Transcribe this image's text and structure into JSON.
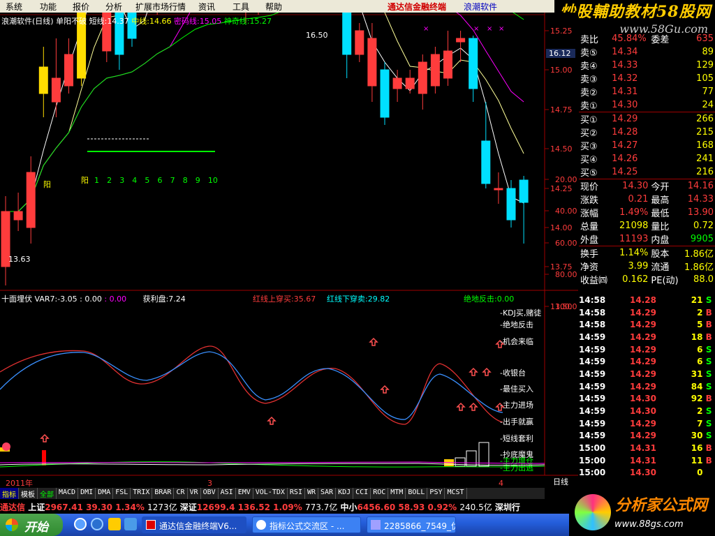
{
  "menu": [
    "系统",
    "功能",
    "报价",
    "分析",
    "扩展市场行情",
    "资讯",
    "工具",
    "帮助"
  ],
  "brand": {
    "name": "通达信金融终端",
    "suffix": "浪潮软件"
  },
  "watermark": {
    "title": "炒股輔助教材58股网",
    "url": "www.58Gu.com"
  },
  "header": {
    "stock": "浪潮软件(日线)",
    "pattern": "单阳不破",
    "short_label": "短线:",
    "short_val": "14.37",
    "mid_label": "中线:",
    "mid_val": "14.66",
    "secret_label": "密码线:",
    "secret_val": "15.05",
    "oracle_label": "神奇线:",
    "oracle_val": "15.27"
  },
  "price_axis": [
    "16.12",
    "16.00",
    "15.75",
    "15.50",
    "15.25",
    "15.00",
    "14.75",
    "14.50",
    "14.25",
    "14.00",
    "13.75",
    "13.50"
  ],
  "high_label": "16.50",
  "low_label": "13.63",
  "yang_labels": {
    "left": "阳",
    "right": "阳",
    "counts": [
      "1",
      "2",
      "3",
      "4",
      "5",
      "6",
      "7",
      "8",
      "9",
      "10"
    ]
  },
  "indicator": {
    "name": "十面埋伏",
    "var_label": "VAR7:",
    "var_val": "-3.05",
    "v1": ": 0.00",
    "v2": ": 0.00",
    "profit_label": "获利盘:",
    "profit_val": "7.24",
    "red_cross_label": "红线上穿买:",
    "red_cross_val": "35.67",
    "blue_cross_label": "红线下穿卖:",
    "blue_cross_val": "29.82",
    "fight_label": "绝地反击:",
    "fight_val": "0.00"
  },
  "indicator_axis": [
    "100.0",
    "80.00",
    "60.00",
    "40.00",
    "20.00"
  ],
  "legend": [
    "KDJ买,赌徒",
    "绝地反击",
    "机会来临",
    "收银台",
    "最佳买入",
    "主力进场",
    "出手就赢",
    "短线套利",
    "抄底魔鬼",
    "主力增仓",
    "主力出逃"
  ],
  "date_axis": {
    "year": "2011年",
    "m3": "3",
    "m4": "4",
    "period": "日线"
  },
  "order_book": {
    "top_left": "卖比",
    "top_val": "45.84%",
    "top_right": "委差",
    "top_right_val": "635",
    "asks": [
      {
        "l": "卖⑤",
        "p": "14.34",
        "v": "89"
      },
      {
        "l": "卖④",
        "p": "14.33",
        "v": "129"
      },
      {
        "l": "卖③",
        "p": "14.32",
        "v": "105"
      },
      {
        "l": "卖②",
        "p": "14.31",
        "v": "77"
      },
      {
        "l": "卖①",
        "p": "14.30",
        "v": "24"
      }
    ],
    "bids": [
      {
        "l": "买①",
        "p": "14.29",
        "v": "266"
      },
      {
        "l": "买②",
        "p": "14.28",
        "v": "215"
      },
      {
        "l": "买③",
        "p": "14.27",
        "v": "168"
      },
      {
        "l": "买④",
        "p": "14.26",
        "v": "241"
      },
      {
        "l": "买⑤",
        "p": "14.25",
        "v": "216"
      }
    ],
    "stats": [
      {
        "a": "现价",
        "av": "14.30",
        "b": "今开",
        "bv": "14.16"
      },
      {
        "a": "涨跌",
        "av": "0.21",
        "b": "最高",
        "bv": "14.33"
      },
      {
        "a": "涨幅",
        "av": "1.49%",
        "b": "最低",
        "bv": "13.90"
      },
      {
        "a": "总量",
        "av": "21098",
        "b": "量比",
        "bv": "0.72"
      },
      {
        "a": "外盘",
        "av": "11193",
        "b": "内盘",
        "bv": "9905"
      },
      {
        "a": "换手",
        "av": "1.14%",
        "b": "股本",
        "bv": "1.86亿"
      },
      {
        "a": "净资",
        "av": "3.99",
        "b": "流通",
        "bv": "1.86亿"
      },
      {
        "a": "收益㈣",
        "av": "0.162",
        "b": "PE(动)",
        "bv": "88.0"
      }
    ]
  },
  "ticks": [
    {
      "t": "14:58",
      "p": "14.28",
      "v": "21",
      "s": "S"
    },
    {
      "t": "14:58",
      "p": "14.29",
      "v": "2",
      "s": "B"
    },
    {
      "t": "14:58",
      "p": "14.29",
      "v": "5",
      "s": "B"
    },
    {
      "t": "14:59",
      "p": "14.29",
      "v": "18",
      "s": "B"
    },
    {
      "t": "14:59",
      "p": "14.29",
      "v": "6",
      "s": "S"
    },
    {
      "t": "14:59",
      "p": "14.29",
      "v": "6",
      "s": "S"
    },
    {
      "t": "14:59",
      "p": "14.29",
      "v": "31",
      "s": "S"
    },
    {
      "t": "14:59",
      "p": "14.29",
      "v": "84",
      "s": "S"
    },
    {
      "t": "14:59",
      "p": "14.30",
      "v": "92",
      "s": "B"
    },
    {
      "t": "14:59",
      "p": "14.30",
      "v": "2",
      "s": "S"
    },
    {
      "t": "14:59",
      "p": "14.29",
      "v": "7",
      "s": "S"
    },
    {
      "t": "14:59",
      "p": "14.29",
      "v": "30",
      "s": "S"
    },
    {
      "t": "15:00",
      "p": "14.31",
      "v": "16",
      "s": "B"
    },
    {
      "t": "15:00",
      "p": "14.31",
      "v": "11",
      "s": "B"
    },
    {
      "t": "15:00",
      "p": "14.30",
      "v": "0",
      "s": ""
    }
  ],
  "tabs": [
    "指标",
    "模板",
    "全部",
    "MACD",
    "DMI",
    "DMA",
    "FSL",
    "TRIX",
    "BRAR",
    "CR",
    "VR",
    "OBV",
    "ASI",
    "EMV",
    "VOL-TDX",
    "RSI",
    "WR",
    "SAR",
    "KDJ",
    "CCI",
    "ROC",
    "MTM",
    "BOLL",
    "PSY",
    "MCST"
  ],
  "ticker": {
    "brand": "通达信",
    "sh_label": "上证",
    "sh": "2967.41",
    "sh_chg": "39.30",
    "sh_pct": "1.34%",
    "sh_amt": "1273亿",
    "sz_label": "深证",
    "sz": "12699.4",
    "sz_chg": "136.52",
    "sz_pct": "1.09%",
    "sz_amt": "773.7亿",
    "zx_label": "中小",
    "zx": "6456.60",
    "zx_chg": "58.93",
    "zx_pct": "0.92%",
    "zx_amt": "240.5亿",
    "tail": "深圳行"
  },
  "taskbar": {
    "start": "开始",
    "tasks": [
      "通达信金融终端V6...",
      "指标公式交流区 - ...",
      "2285866_7549_优..."
    ]
  },
  "bottom_logo": {
    "title": "分析家公式网",
    "url": "www.88gs.com"
  },
  "chart_data": {
    "type": "candlestick",
    "candles": [
      {
        "o": 13.75,
        "c": 14.1,
        "h": 14.2,
        "l": 13.63
      },
      {
        "o": 14.05,
        "c": 14.1,
        "h": 14.22,
        "l": 13.98
      },
      {
        "o": 14.0,
        "c": 14.35,
        "h": 14.45,
        "l": 13.9
      },
      {
        "o": 14.85,
        "c": 15.02,
        "h": 15.15,
        "l": 14.7
      },
      {
        "o": 14.8,
        "c": 14.95,
        "h": 15.2,
        "l": 14.7
      },
      {
        "o": 14.9,
        "c": 15.1,
        "h": 15.2,
        "l": 14.85
      },
      {
        "o": 14.95,
        "c": 15.75,
        "h": 15.95,
        "l": 14.9
      },
      {
        "o": 15.7,
        "c": 15.7,
        "h": 15.8,
        "l": 15.6
      },
      {
        "o": 15.12,
        "c": 15.48,
        "h": 15.6,
        "l": 15.05
      },
      {
        "o": 15.5,
        "c": 15.1,
        "h": 15.6,
        "l": 15.0
      },
      {
        "o": 15.55,
        "c": 15.2,
        "h": 15.7,
        "l": 15.15
      },
      {
        "o": 15.55,
        "c": 15.65,
        "h": 15.7,
        "l": 15.5
      },
      {
        "o": 15.45,
        "c": 15.85,
        "h": 15.95,
        "l": 15.35
      },
      {
        "o": 15.7,
        "c": 15.72,
        "h": 15.8,
        "l": 15.6
      },
      {
        "o": 15.75,
        "c": 16.0,
        "h": 16.1,
        "l": 15.65
      },
      {
        "o": 16.1,
        "c": 16.07,
        "h": 16.15,
        "l": 16.0
      },
      {
        "o": 16.05,
        "c": 15.8,
        "h": 16.1,
        "l": 15.7
      },
      {
        "o": 15.75,
        "c": 15.45,
        "h": 15.8,
        "l": 15.4
      },
      {
        "o": 15.6,
        "c": 15.55,
        "h": 15.65,
        "l": 15.45
      },
      {
        "o": 15.4,
        "c": 15.55,
        "h": 15.6,
        "l": 15.3
      },
      {
        "o": 15.4,
        "c": 15.55,
        "h": 15.7,
        "l": 15.35
      },
      {
        "o": 15.55,
        "c": 15.65,
        "h": 15.7,
        "l": 15.5
      },
      {
        "o": 15.7,
        "c": 16.0,
        "h": 16.05,
        "l": 15.6
      },
      {
        "o": 15.85,
        "c": 16.2,
        "h": 16.5,
        "l": 15.8
      },
      {
        "o": 16.05,
        "c": 16.1,
        "h": 16.15,
        "l": 16.0
      },
      {
        "o": 15.85,
        "c": 16.05,
        "h": 16.1,
        "l": 15.8
      },
      {
        "o": 15.77,
        "c": 15.9,
        "h": 15.95,
        "l": 15.7
      },
      {
        "o": 15.75,
        "c": 15.1,
        "h": 15.8,
        "l": 14.95
      },
      {
        "o": 15.1,
        "c": 15.25,
        "h": 15.3,
        "l": 15.05
      },
      {
        "o": 14.9,
        "c": 15.2,
        "h": 15.3,
        "l": 14.8
      },
      {
        "o": 15.0,
        "c": 14.7,
        "h": 15.05,
        "l": 14.65
      },
      {
        "o": 14.88,
        "c": 14.95,
        "h": 15.0,
        "l": 14.8
      },
      {
        "o": 14.88,
        "c": 14.95,
        "h": 15.0,
        "l": 14.85
      },
      {
        "o": 14.85,
        "c": 15.05,
        "h": 15.1,
        "l": 14.75
      },
      {
        "o": 14.9,
        "c": 15.1,
        "h": 15.15,
        "l": 14.85
      },
      {
        "o": 14.95,
        "c": 15.12,
        "h": 15.25,
        "l": 14.9
      },
      {
        "o": 15.18,
        "c": 15.2,
        "h": 15.25,
        "l": 15.05
      },
      {
        "o": 15.2,
        "c": 14.88,
        "h": 15.22,
        "l": 14.8
      },
      {
        "o": 14.55,
        "c": 14.28,
        "h": 14.8,
        "l": 14.25
      },
      {
        "o": 14.25,
        "c": 14.25,
        "h": 14.35,
        "l": 14.15
      },
      {
        "o": 14.25,
        "c": 14.05,
        "h": 14.3,
        "l": 14.0
      },
      {
        "o": 14.3,
        "c": 14.16,
        "h": 14.33,
        "l": 13.9
      }
    ]
  }
}
